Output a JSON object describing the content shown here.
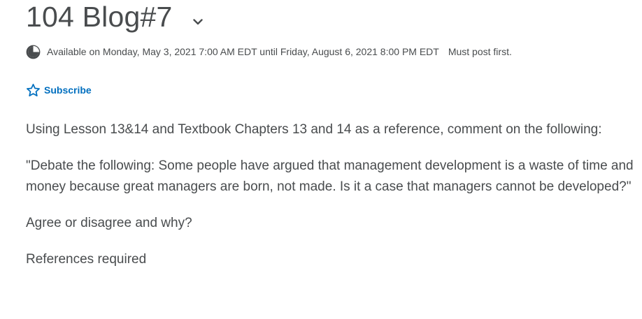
{
  "topic": {
    "title": "104 Blog#7",
    "expand_icon": "chevron-down-icon"
  },
  "availability": {
    "icon": "clock-icon",
    "text": "Available on Monday, May 3, 2021 7:00 AM EDT until Friday, August 6, 2021 8:00 PM EDT",
    "must_post": "Must post first."
  },
  "subscribe": {
    "icon": "star-outline-icon",
    "label": "Subscribe",
    "color": "#006fbf"
  },
  "description": {
    "paragraph_1": "Using Lesson 13&14 and Textbook Chapters 13 and 14 as a reference, comment on the following:",
    "paragraph_2": "\"Debate the following: Some people have argued that management development is a waste of time and money because great managers are born, not made. Is it a case that managers cannot be developed?\"",
    "paragraph_3": "Agree or disagree and why?",
    "paragraph_4": "References required"
  },
  "colors": {
    "text": "#494c4e",
    "link": "#006fbf",
    "background": "#ffffff"
  }
}
